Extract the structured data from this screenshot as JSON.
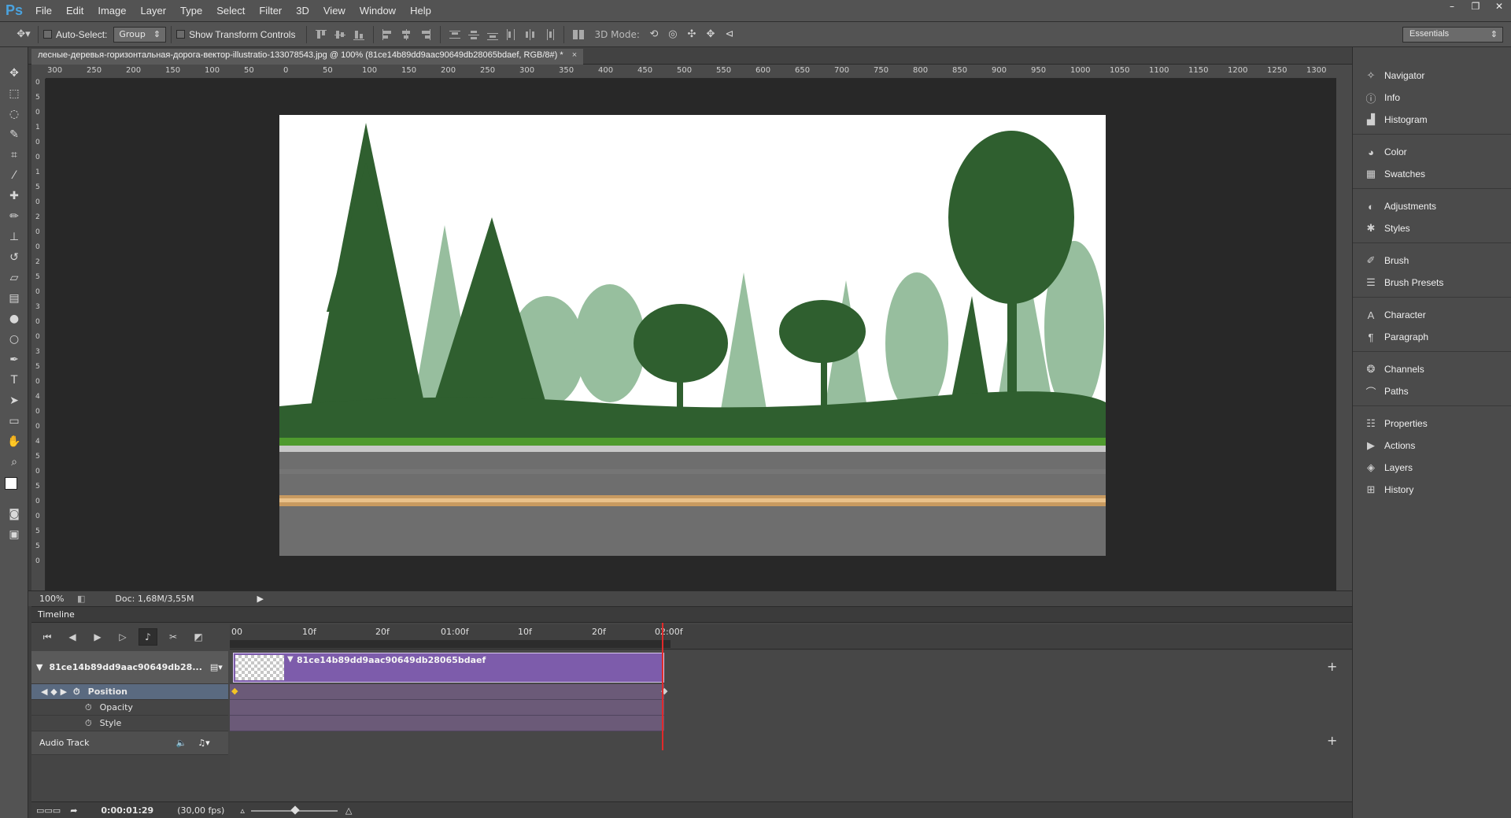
{
  "app": {
    "logo": "Ps"
  },
  "menu": [
    "File",
    "Edit",
    "Image",
    "Layer",
    "Type",
    "Select",
    "Filter",
    "3D",
    "View",
    "Window",
    "Help"
  ],
  "window_controls": [
    "–",
    "❐",
    "✕"
  ],
  "options": {
    "auto_select_label": "Auto-Select:",
    "auto_select_value": "Group",
    "show_transform_label": "Show Transform Controls",
    "mode_label": "3D Mode:",
    "workspace": "Essentials"
  },
  "document": {
    "tab_title": "лесные-деревья-горизонтальная-дорога-вектор-illustratio-133078543.jpg @ 100% (81ce14b89dd9aac90649db28065bdaef, RGB/8#) *",
    "close": "×"
  },
  "ruler_h": [
    "300",
    "250",
    "200",
    "150",
    "100",
    "50",
    "0",
    "50",
    "100",
    "150",
    "200",
    "250",
    "300",
    "350",
    "400",
    "450",
    "500",
    "550",
    "600",
    "650",
    "700",
    "750",
    "800",
    "850",
    "900",
    "950",
    "1000",
    "1050",
    "1100",
    "1150",
    "1200",
    "1250",
    "1300"
  ],
  "ruler_v": [
    "0",
    "5",
    "0",
    "1",
    "0",
    "0",
    "1",
    "5",
    "0",
    "2",
    "0",
    "0",
    "2",
    "5",
    "0",
    "3",
    "0",
    "0",
    "3",
    "5",
    "0",
    "4",
    "0",
    "0",
    "4",
    "5",
    "0",
    "5",
    "0",
    "0",
    "5",
    "5",
    "0"
  ],
  "status": {
    "zoom": "100%",
    "doc_size": "Doc: 1,68M/3,55M"
  },
  "timeline": {
    "title": "Timeline",
    "ticks": [
      "00",
      "10f",
      "20f",
      "01:00f",
      "10f",
      "20f",
      "02:00f"
    ],
    "layer_name": "81ce14b89dd9aac90649db28...",
    "clip_name": "81ce14b89dd9aac90649db28065bdaef",
    "properties": [
      "Position",
      "Opacity",
      "Style"
    ],
    "audio_track": "Audio Track",
    "current_time": "0:00:01:29",
    "fps": "(30,00 fps)",
    "add": "+"
  },
  "panels": [
    [
      {
        "label": "Navigator",
        "icon": "navigator-icon"
      },
      {
        "label": "Info",
        "icon": "info-icon"
      },
      {
        "label": "Histogram",
        "icon": "histogram-icon"
      }
    ],
    [
      {
        "label": "Color",
        "icon": "color-icon"
      },
      {
        "label": "Swatches",
        "icon": "swatches-icon"
      }
    ],
    [
      {
        "label": "Adjustments",
        "icon": "adjustments-icon"
      },
      {
        "label": "Styles",
        "icon": "styles-icon"
      }
    ],
    [
      {
        "label": "Brush",
        "icon": "brush-icon"
      },
      {
        "label": "Brush Presets",
        "icon": "brush-presets-icon"
      }
    ],
    [
      {
        "label": "Character",
        "icon": "character-icon"
      },
      {
        "label": "Paragraph",
        "icon": "paragraph-icon"
      }
    ],
    [
      {
        "label": "Channels",
        "icon": "channels-icon"
      },
      {
        "label": "Paths",
        "icon": "paths-icon"
      }
    ],
    [
      {
        "label": "Properties",
        "icon": "properties-icon"
      },
      {
        "label": "Actions",
        "icon": "actions-icon"
      },
      {
        "label": "Layers",
        "icon": "layers-icon"
      },
      {
        "label": "History",
        "icon": "history-icon"
      }
    ]
  ],
  "colors": {
    "accent": "#4aa3df",
    "clip": "#7d5cab",
    "playhead": "#e12a2a",
    "forest_dark": "#2f5f2f",
    "forest_light": "#8cb894",
    "road": "#6e6e6e"
  }
}
